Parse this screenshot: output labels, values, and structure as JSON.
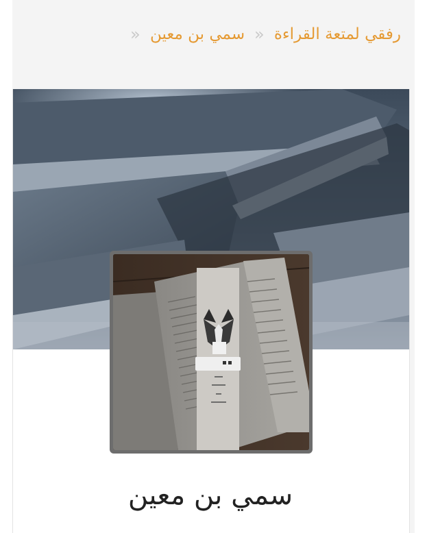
{
  "breadcrumb": {
    "items": [
      {
        "label": "رفقي لمتعة القراءة"
      },
      {
        "label": "سمي بن معين"
      }
    ]
  },
  "profile": {
    "name": "سمي بن معين"
  },
  "colors": {
    "breadcrumb_link": "#e59a33",
    "separator": "#c9c9c9",
    "panel_background": "#f4f4f4",
    "name_text": "#222222"
  },
  "icons": {
    "separator": "double-chevron-icon",
    "avatar": "cat-bookmark-avatar-image",
    "cover": "books-cover-image"
  }
}
